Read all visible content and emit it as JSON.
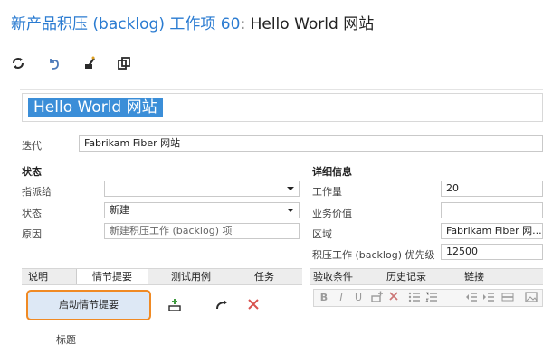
{
  "header": {
    "prefix": "新产品积压 (backlog) 工作项 60",
    "separator": ":",
    "title": "Hello World 网站"
  },
  "toolbar": {
    "icons": [
      "refresh-icon",
      "undo-icon",
      "edit-icon",
      "copy-icon"
    ]
  },
  "work_item": {
    "title": "Hello World 网站",
    "iteration_label": "迭代",
    "iteration_value": "Fabrikam Fiber 网站"
  },
  "status": {
    "heading": "状态",
    "assigned_to_label": "指派给",
    "assigned_to_value": "",
    "state_label": "状态",
    "state_value": "新建",
    "reason_label": "原因",
    "reason_value": "新建积压工作 (backlog) 项"
  },
  "details": {
    "heading": "详细信息",
    "effort_label": "工作量",
    "effort_value": "20",
    "business_value_label": "业务价值",
    "business_value_value": "",
    "area_label": "区域",
    "area_value": "Fabrikam Fiber 网...",
    "priority_label": "积压工作 (backlog) 优先级",
    "priority_value": "12500"
  },
  "tabs_left": [
    "说明",
    "情节提要",
    "测试用例",
    "任务"
  ],
  "tabs_right": [
    "验收条件",
    "历史记录",
    "链接"
  ],
  "formatting": [
    "B",
    "I",
    "U"
  ],
  "storyboard": {
    "button_label": "启动情节提要",
    "column_header": "标题"
  },
  "colors": {
    "link_blue": "#2a7bd1",
    "title_highlight": "#3b8ed8",
    "focus_orange": "#f08a24",
    "delete_red": "#d9534f",
    "add_green": "#3f9b3f"
  }
}
